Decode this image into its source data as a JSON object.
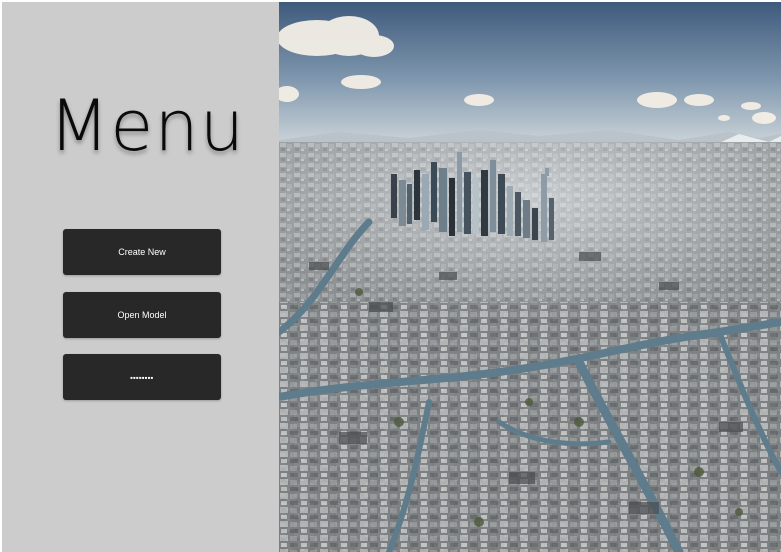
{
  "menu": {
    "title": "Menu",
    "buttons": [
      {
        "label": "Create New"
      },
      {
        "label": "Open Model"
      },
      {
        "label": "■■■■■■■■"
      }
    ]
  },
  "hero_image": {
    "description": "aerial-city-skyline-icon"
  },
  "colors": {
    "panel_bg": "#cccccc",
    "button_bg": "#282828",
    "button_text": "#ffffff",
    "title_text": "#0a0a0a"
  }
}
